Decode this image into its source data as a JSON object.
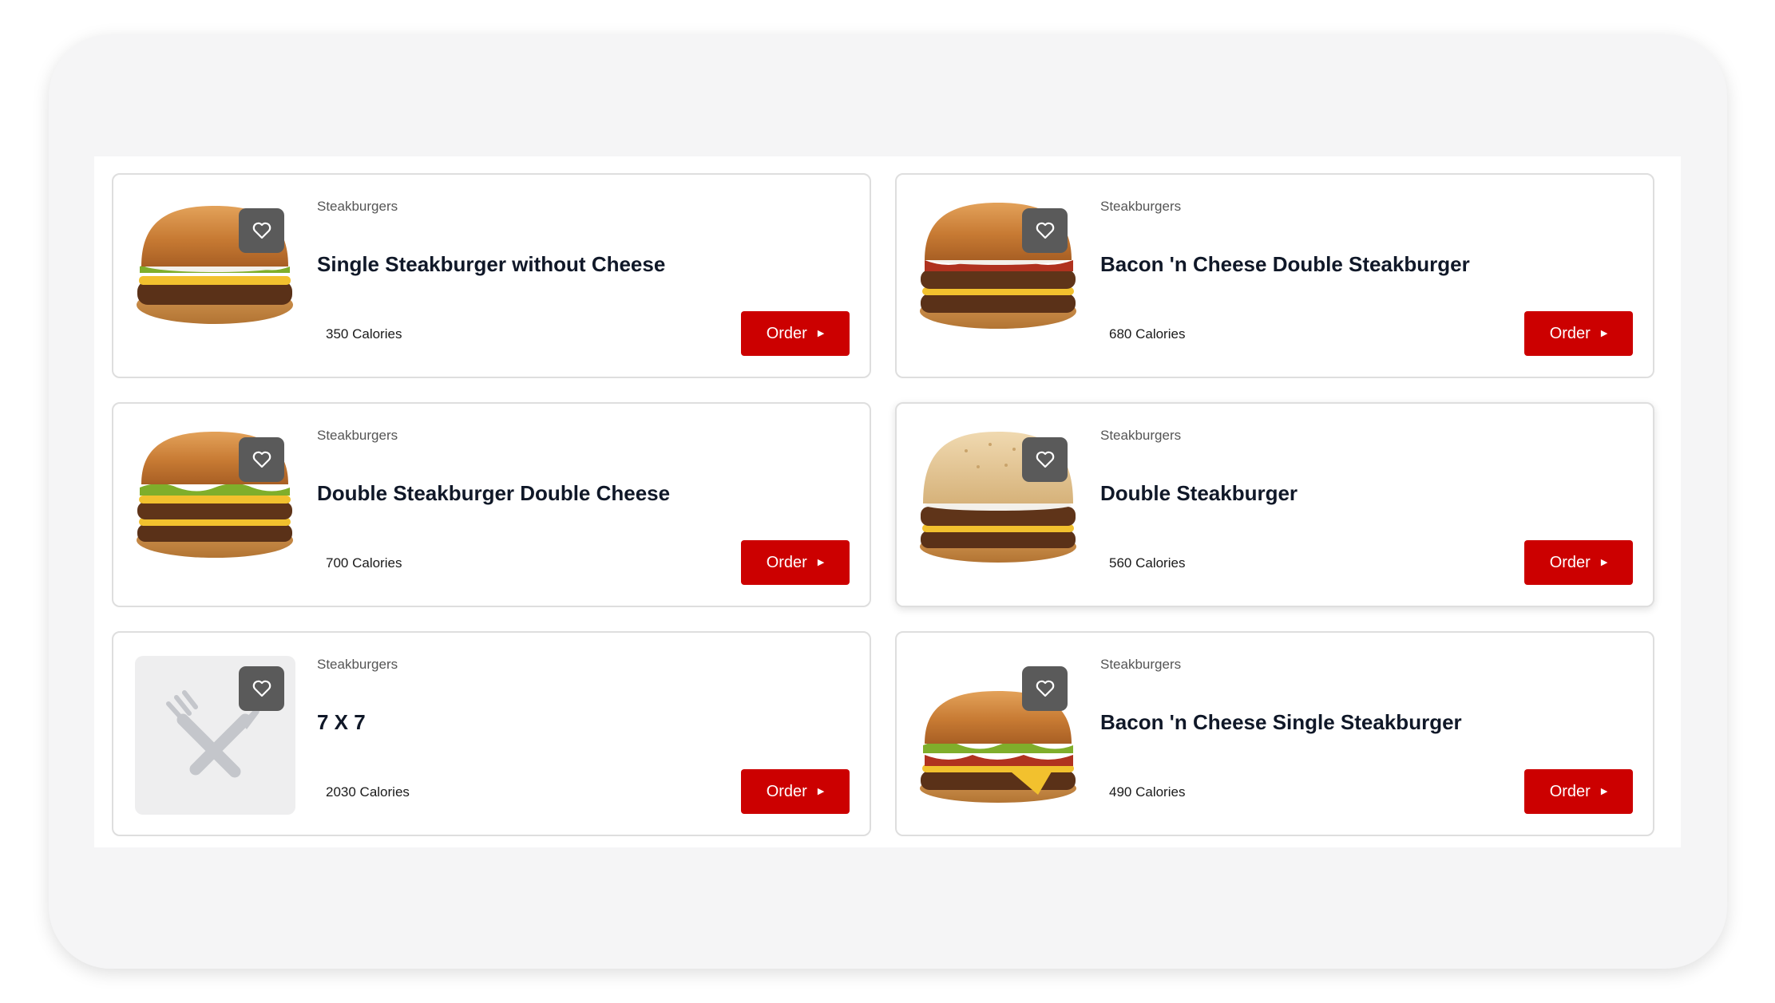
{
  "menu_items": [
    {
      "category": "Steakburgers",
      "name": "Single Steakburger without Cheese",
      "calories": "350 Calories",
      "order_label": "Order",
      "image": "single-burger"
    },
    {
      "category": "Steakburgers",
      "name": "Bacon 'n Cheese Double Steakburger",
      "calories": "680 Calories",
      "order_label": "Order",
      "image": "bacon-double-burger"
    },
    {
      "category": "Steakburgers",
      "name": "Double Steakburger Double Cheese",
      "calories": "700 Calories",
      "order_label": "Order",
      "image": "double-cheese-burger"
    },
    {
      "category": "Steakburgers",
      "name": "Double Steakburger",
      "calories": "560 Calories",
      "order_label": "Order",
      "image": "double-burger"
    },
    {
      "category": "Steakburgers",
      "name": "7 X 7",
      "calories": "2030 Calories",
      "order_label": "Order",
      "image": "placeholder-utensils"
    },
    {
      "category": "Steakburgers",
      "name": "Bacon 'n Cheese Single Steakburger",
      "calories": "490 Calories",
      "order_label": "Order",
      "image": "bacon-single-burger"
    }
  ],
  "icons": {
    "favorite": "heart-outline-icon",
    "order_arrow": "play-triangle-icon",
    "placeholder": "fork-knife-icon"
  },
  "colors": {
    "order_button": "#cc0000",
    "favorite_badge": "#5a5a5a",
    "title_text": "#101828"
  }
}
